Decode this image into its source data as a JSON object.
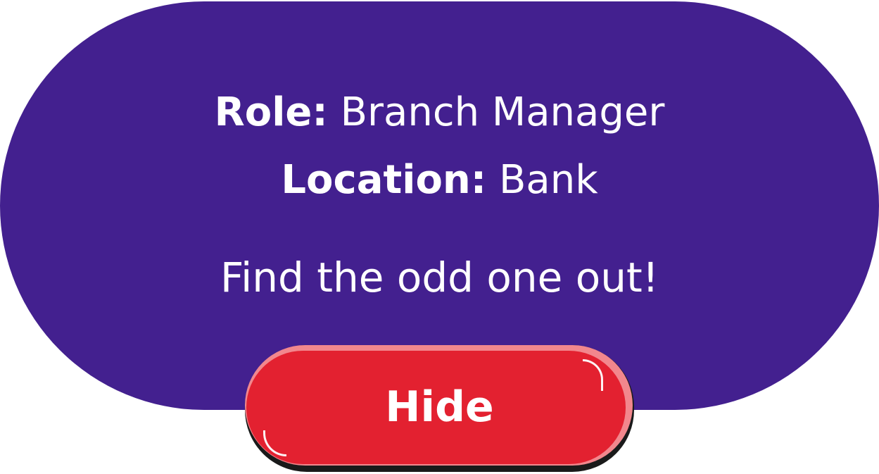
{
  "card": {
    "role_label": "Role:",
    "role_value": "Branch Manager",
    "location_label": "Location:",
    "location_value": "Bank",
    "instruction": "Find the odd one out!"
  },
  "button": {
    "label": "Hide"
  },
  "colors": {
    "card_background": "#43208f",
    "button_red": "#e32130",
    "button_highlight": "#f2878d",
    "button_shadow": "#1a1a1a",
    "text": "#ffffff"
  }
}
